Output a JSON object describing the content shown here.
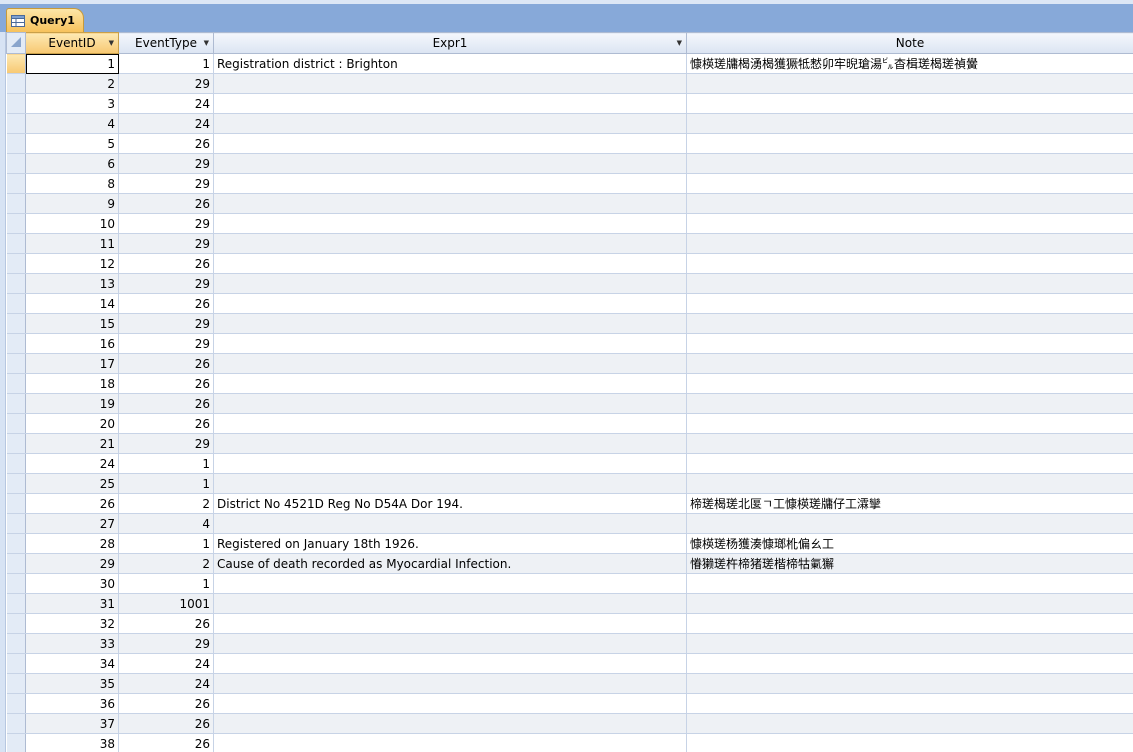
{
  "tab": {
    "title": "Query1",
    "icon": "query-icon"
  },
  "columns": [
    {
      "label": "EventID",
      "dropdown": true
    },
    {
      "label": "EventType",
      "dropdown": true
    },
    {
      "label": "Expr1",
      "dropdown": true
    },
    {
      "label": "Note",
      "dropdown": false
    }
  ],
  "rows": [
    {
      "id": "1",
      "type": "1",
      "expr": "Registration district : Brighton",
      "note": "慷楧瑳牗楬湧楬獲獗牴慭卯牢晲瑲湯㌱杳楫瑳楬瑳禎黌"
    },
    {
      "id": "2",
      "type": "29",
      "expr": "",
      "note": ""
    },
    {
      "id": "3",
      "type": "24",
      "expr": "",
      "note": ""
    },
    {
      "id": "4",
      "type": "24",
      "expr": "",
      "note": ""
    },
    {
      "id": "5",
      "type": "26",
      "expr": "",
      "note": ""
    },
    {
      "id": "6",
      "type": "29",
      "expr": "",
      "note": ""
    },
    {
      "id": "8",
      "type": "29",
      "expr": "",
      "note": ""
    },
    {
      "id": "9",
      "type": "26",
      "expr": "",
      "note": ""
    },
    {
      "id": "10",
      "type": "29",
      "expr": "",
      "note": ""
    },
    {
      "id": "11",
      "type": "29",
      "expr": "",
      "note": ""
    },
    {
      "id": "12",
      "type": "26",
      "expr": "",
      "note": ""
    },
    {
      "id": "13",
      "type": "29",
      "expr": "",
      "note": ""
    },
    {
      "id": "14",
      "type": "26",
      "expr": "",
      "note": ""
    },
    {
      "id": "15",
      "type": "29",
      "expr": "",
      "note": ""
    },
    {
      "id": "16",
      "type": "29",
      "expr": "",
      "note": ""
    },
    {
      "id": "17",
      "type": "26",
      "expr": "",
      "note": ""
    },
    {
      "id": "18",
      "type": "26",
      "expr": "",
      "note": ""
    },
    {
      "id": "19",
      "type": "26",
      "expr": "",
      "note": ""
    },
    {
      "id": "20",
      "type": "26",
      "expr": "",
      "note": ""
    },
    {
      "id": "21",
      "type": "29",
      "expr": "",
      "note": ""
    },
    {
      "id": "24",
      "type": "1",
      "expr": "",
      "note": ""
    },
    {
      "id": "25",
      "type": "1",
      "expr": "",
      "note": ""
    },
    {
      "id": "26",
      "type": "2",
      "expr": "District No 4521D Reg No D54A Dor 194.",
      "note": "楴瑳楬瑳北匽ㄱ⼯慷楧瑳牗仔⼯瀮攣"
    },
    {
      "id": "27",
      "type": "4",
      "expr": "",
      "note": ""
    },
    {
      "id": "28",
      "type": "1",
      "expr": "Registered on January 18th 1926.",
      "note": "慷楧瑳杨獲湊慷瑯杹偏ㄠ⼯"
    },
    {
      "id": "29",
      "type": "2",
      "expr": "Cause of death recorded as Myocardial Infection.",
      "note": "慻獭瑳杵楴猪瑳楷楴牯氭獬"
    },
    {
      "id": "30",
      "type": "1",
      "expr": "",
      "note": ""
    },
    {
      "id": "31",
      "type": "1001",
      "expr": "",
      "note": ""
    },
    {
      "id": "32",
      "type": "26",
      "expr": "",
      "note": ""
    },
    {
      "id": "33",
      "type": "29",
      "expr": "",
      "note": ""
    },
    {
      "id": "34",
      "type": "24",
      "expr": "",
      "note": ""
    },
    {
      "id": "35",
      "type": "24",
      "expr": "",
      "note": ""
    },
    {
      "id": "36",
      "type": "26",
      "expr": "",
      "note": ""
    },
    {
      "id": "37",
      "type": "26",
      "expr": "",
      "note": ""
    },
    {
      "id": "38",
      "type": "26",
      "expr": "",
      "note": ""
    }
  ],
  "current_row": 0
}
